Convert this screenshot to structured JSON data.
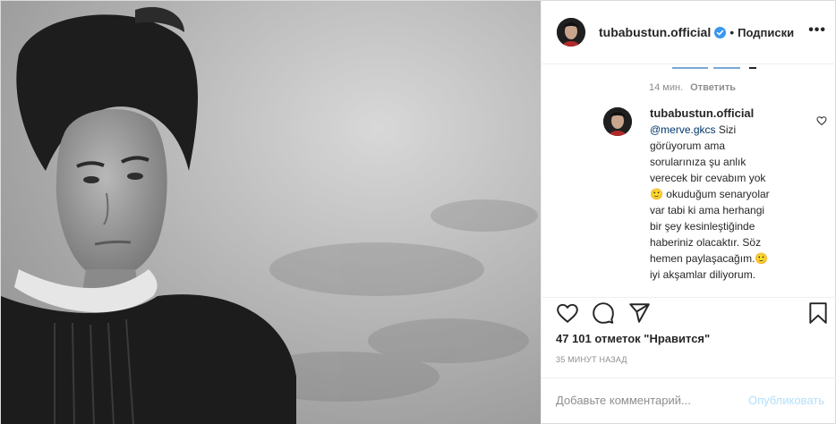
{
  "header": {
    "username": "tubabustun.official",
    "dot": "•",
    "follow_label": "Подписки",
    "more_label": "•••"
  },
  "comments": {
    "time": "14 мин.",
    "reply_label": "Ответить",
    "reply": {
      "username": "tubabustun.official",
      "mention": "@merve.gkcs",
      "text": " Sizi görüyorum ama sorularınıza şu anlık verecek bir cevabım yok 🙂 okuduğum senaryolar var tabi ki ama herhangi bir şey kesinleştiğinde haberiniz olacaktır. Söz hemen paylaşacağım.🙂 iyi akşamlar diliyorum."
    }
  },
  "actions": {
    "icons": [
      "heart-icon",
      "comment-icon",
      "share-icon",
      "bookmark-icon"
    ],
    "likes": "47 101 отметок \"Нравится\"",
    "time_ago": "35 МИНУТ НАЗАД"
  },
  "add_comment": {
    "placeholder": "Добавьте комментарий...",
    "publish_label": "Опубликовать"
  },
  "colors": {
    "text": "#262626",
    "muted": "#8e8e8e",
    "verified": "#3897f0",
    "publish_disabled": "#b2dffc",
    "mention": "#00376b"
  }
}
